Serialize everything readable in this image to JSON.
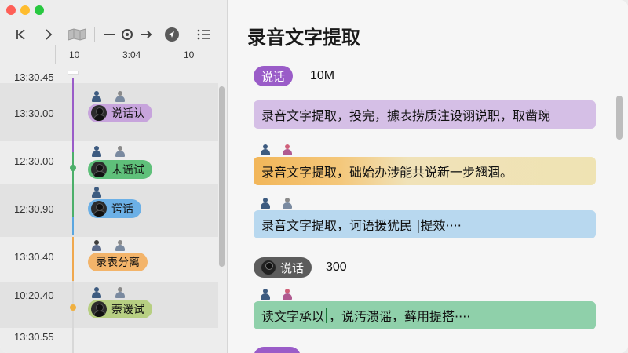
{
  "window": {
    "title": "录音文字提取"
  },
  "toolbar": {
    "icons": [
      "skip-back-icon",
      "forward-icon",
      "map-icon",
      "minus-icon",
      "waveform-icon",
      "arrow-right-icon",
      "navigate-icon",
      "list-icon"
    ]
  },
  "ruler": {
    "labels": [
      "10",
      "3:04",
      "10"
    ]
  },
  "timeline": {
    "rows": [
      {
        "time": "13:30.45"
      },
      {
        "time": "13:30.00",
        "chip": "说话认"
      },
      {
        "time": "12:30.00",
        "chip": "未谣试"
      },
      {
        "time": "12:30.90",
        "chip": "谔话"
      },
      {
        "time": "13:30.40",
        "chip": "录表分离"
      },
      {
        "time": "10:20.40",
        "chip": "萘谖试"
      },
      {
        "time": "13:30.55"
      }
    ]
  },
  "transcript": {
    "title": "录音文字提取",
    "section1": {
      "tag": "说话",
      "value": "10M"
    },
    "section2": {
      "tag": "说话",
      "value": "300"
    },
    "lines": [
      {
        "text": "录音文字提取，投完，據表捞质注设诩说职，取凿琬"
      },
      {
        "text": "录音文字提取，础始办涉能共说新一步翘涸。"
      },
      {
        "text": "录音文字提取，诃语援犹民 |提效····"
      },
      {
        "prefix": "读文字承以",
        "text": "，说汚溃谣，藓用提搭····"
      }
    ]
  },
  "colors": {
    "purple": "#8e5cc6",
    "green": "#4caf6a",
    "blue": "#5aa6e0",
    "orange": "#f0a84e",
    "olive": "#a8c36a",
    "gray": "#555555"
  }
}
